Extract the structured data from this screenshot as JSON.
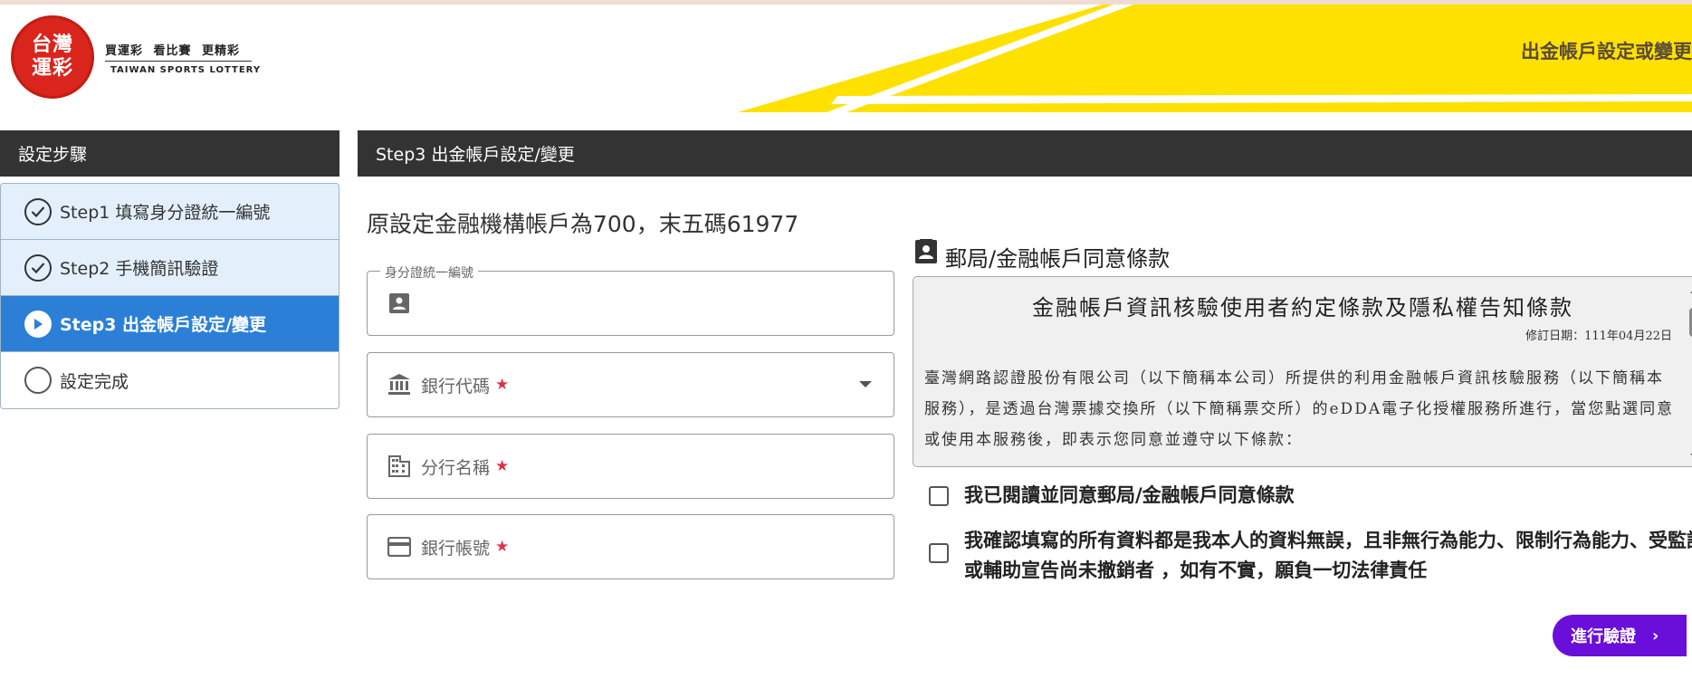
{
  "header": {
    "logo_top": "台灣",
    "logo_bottom": "運彩",
    "slogan": "買運彩 看比賽 更精彩",
    "english_name": "TAIWAN SPORTS LOTTERY",
    "page_title": "出金帳戶設定或變更",
    "accent_color": "#ffe100"
  },
  "sidebar": {
    "title": "設定步驟",
    "steps": [
      {
        "label": "Step1 填寫身分證統一編號",
        "state": "done"
      },
      {
        "label": "Step2 手機簡訊驗證",
        "state": "done"
      },
      {
        "label": "Step3 出金帳戶設定/變更",
        "state": "active"
      },
      {
        "label": "設定完成",
        "state": "todo"
      }
    ]
  },
  "main": {
    "title": "Step3 出金帳戶設定/變更",
    "original_account": "原設定金融機構帳戶為700，末五碼61977",
    "fields": {
      "id_number": {
        "legend": "身分證統一編號",
        "value": "",
        "icon": "id-card-icon"
      },
      "bank_code": {
        "label": "銀行代碼",
        "required_mark": "★",
        "icon": "bank-icon"
      },
      "branch_name": {
        "label": "分行名稱",
        "required_mark": "★",
        "icon": "building-icon"
      },
      "account_number": {
        "label": "銀行帳號",
        "required_mark": "★",
        "icon": "credit-card-icon"
      }
    }
  },
  "terms": {
    "section_title": "郵局/金融帳戶同意條款",
    "heading": "金融帳戶資訊核驗使用者約定條款及隱私權告知條款",
    "revised_date": "修訂日期：111年04月22日",
    "body": "臺灣網路認證股份有限公司（以下簡稱本公司）所提供的利用金融帳戶資訊核驗服務（以下簡稱本服務），是透過台灣票據交換所（以下簡稱票交所）的eDDA電子化授權服務所進行，當您點選同意或使用本服務後，即表示您同意並遵守以下條款：",
    "checkbox_agree": "我已閱讀並同意郵局/金融帳戶同意條款",
    "checkbox_confirm": "我確認填寫的所有資料都是我本人的資料無誤，且非無行為能力、限制行為能力、受監護或輔助宣告尚未撤銷者 ，如有不實，願負一切法律責任"
  },
  "actions": {
    "verify_label": "進行驗證",
    "verify_chevron": "›",
    "button_color": "#6a0ed9"
  }
}
